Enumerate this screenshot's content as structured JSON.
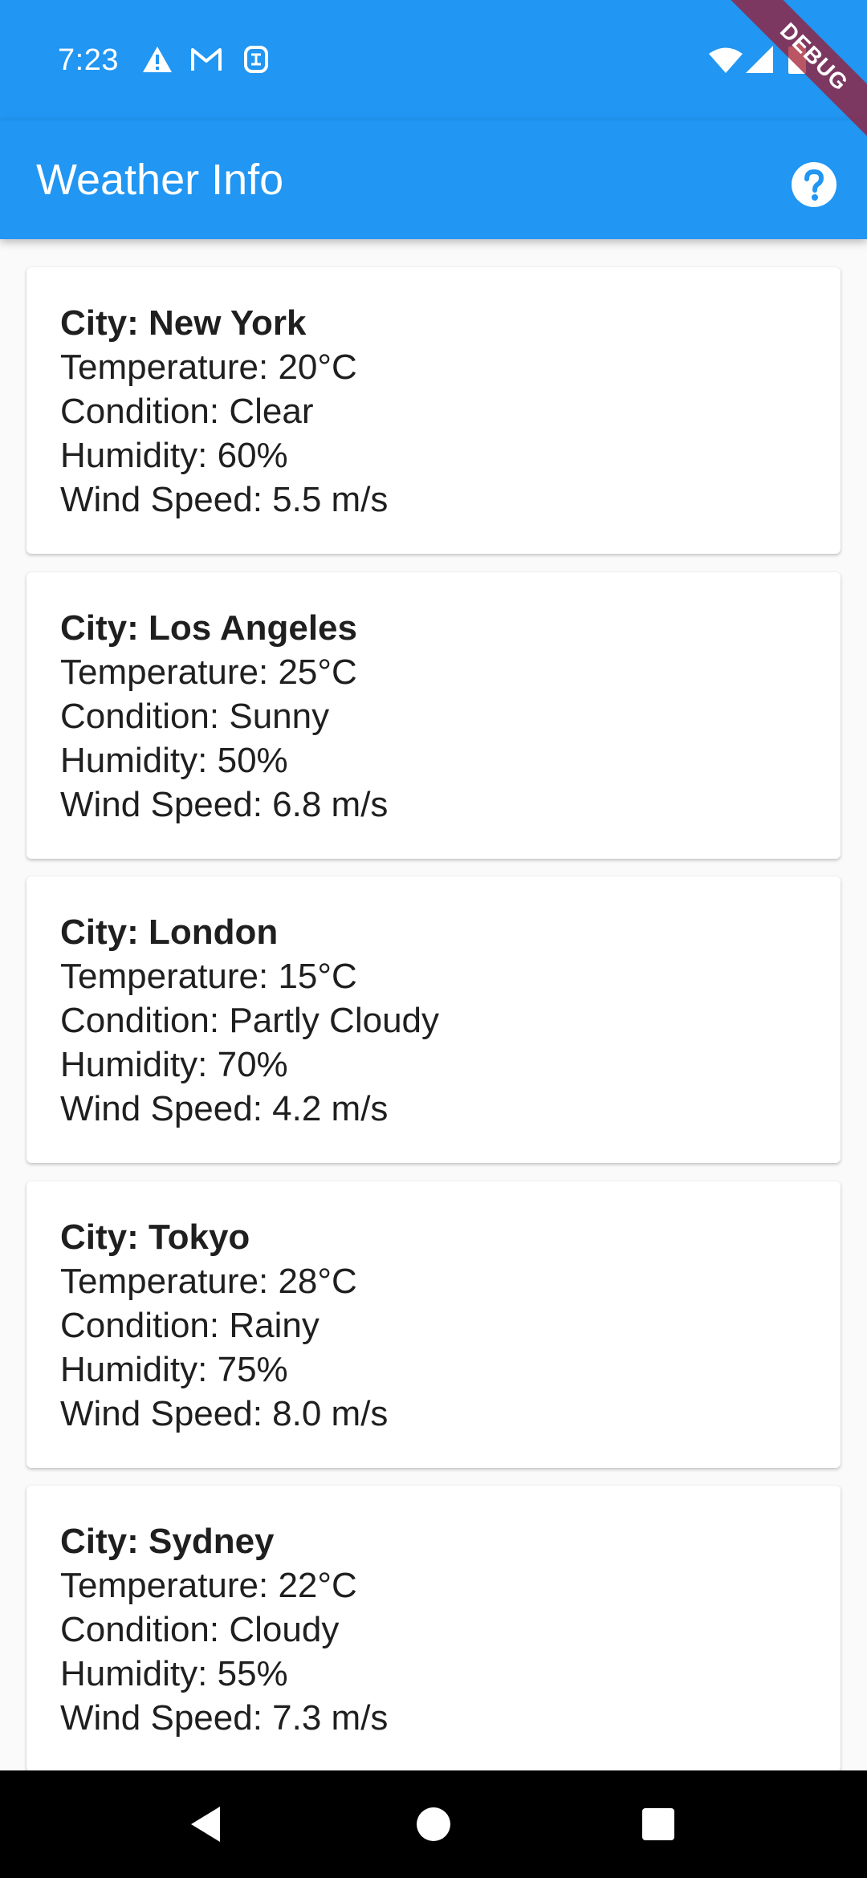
{
  "status_bar": {
    "time": "7:23",
    "left_icons": [
      "warning-icon",
      "gmail-icon",
      "sim-icon"
    ],
    "right_icons": [
      "wifi-icon",
      "cellular-signal-icon",
      "battery-icon"
    ]
  },
  "app_bar": {
    "title": "Weather Info",
    "action_icon": "help-icon",
    "color": "#2196f3"
  },
  "debug_banner": {
    "label": "DEBUG"
  },
  "cities": [
    {
      "city": "City: New York",
      "temperature": "Temperature: 20°C",
      "condition": "Condition: Clear",
      "humidity": "Humidity: 60%",
      "wind_speed": "Wind Speed: 5.5 m/s"
    },
    {
      "city": "City: Los Angeles",
      "temperature": "Temperature: 25°C",
      "condition": "Condition: Sunny",
      "humidity": "Humidity: 50%",
      "wind_speed": "Wind Speed: 6.8 m/s"
    },
    {
      "city": "City: London",
      "temperature": "Temperature: 15°C",
      "condition": "Condition: Partly Cloudy",
      "humidity": "Humidity: 70%",
      "wind_speed": "Wind Speed: 4.2 m/s"
    },
    {
      "city": "City: Tokyo",
      "temperature": "Temperature: 28°C",
      "condition": "Condition: Rainy",
      "humidity": "Humidity: 75%",
      "wind_speed": "Wind Speed: 8.0 m/s"
    },
    {
      "city": "City: Sydney",
      "temperature": "Temperature: 22°C",
      "condition": "Condition: Cloudy",
      "humidity": "Humidity: 55%",
      "wind_speed": "Wind Speed: 7.3 m/s"
    }
  ],
  "nav_bar": {
    "buttons": [
      "back-icon",
      "home-icon",
      "recents-icon"
    ]
  }
}
